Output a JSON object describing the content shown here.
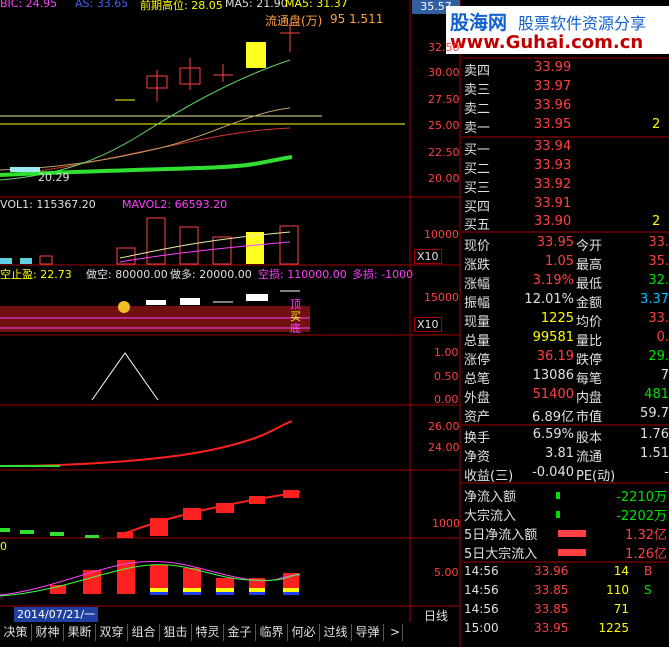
{
  "brand": {
    "logo_text": "股海网",
    "slogan": "股票软件资源分享",
    "url": "www.Guhai.com.cn"
  },
  "header": {
    "frag1": "BIC: 24.95",
    "frag2": "AS: 33.65",
    "frag3": "前期高位: 28.05",
    "frag4": "MA5: 21.90",
    "frag5": "MA5: 31.37",
    "float_label": "流通盘(万)",
    "float_val": "95  1.511",
    "price_box": "35.57"
  },
  "price_axis": [
    "32.50",
    "30.00",
    "27.50",
    "25.00",
    "22.50",
    "20.00"
  ],
  "low_label": "20.29",
  "vol_axis": [
    "10000"
  ],
  "x10": "X10",
  "x10_b": "X10",
  "vol_header": {
    "vol1": "VOL1: 115367.20",
    "vol2": "MAVOL2: 66593.20"
  },
  "sub_header": {
    "stop": "空止盈: 22.73",
    "short": "做空: 80000.00",
    "long": "做多: 20000.00",
    "air": "空损: 110000.00",
    "more": "多损: -1000"
  },
  "pane3_axis": [
    "15000"
  ],
  "pane3_marks": {
    "a": "顶",
    "b": "买",
    "c": "底"
  },
  "pane4_axis": [
    "1.00",
    "0.50",
    "0.00"
  ],
  "pane5_axis": [
    "26.00",
    "24.00"
  ],
  "pane6_axis": [
    "1000"
  ],
  "pane7_axis": [
    "5.00",
    "0"
  ],
  "date_label": "2014/07/21/一",
  "period": "日线",
  "sell_orders": [
    {
      "label": "卖四",
      "price": "33.99"
    },
    {
      "label": "卖三",
      "price": "33.97"
    },
    {
      "label": "卖二",
      "price": "33.96"
    },
    {
      "label": "卖一",
      "price": "33.95",
      "vol": "2"
    }
  ],
  "buy_orders": [
    {
      "label": "买一",
      "price": "33.94"
    },
    {
      "label": "买二",
      "price": "33.93"
    },
    {
      "label": "买三",
      "price": "33.92"
    },
    {
      "label": "买四",
      "price": "33.91"
    },
    {
      "label": "买五",
      "price": "33.90",
      "vol": "2"
    }
  ],
  "stats": [
    {
      "l1": "现价",
      "v1": "33.95",
      "c1": "#ff4040",
      "l2": "今开",
      "v2": "33.",
      "c2": "#ff4040"
    },
    {
      "l1": "涨跌",
      "v1": "1.05",
      "c1": "#ff4040",
      "l2": "最高",
      "v2": "35.",
      "c2": "#ff4040"
    },
    {
      "l1": "涨幅",
      "v1": "3.19%",
      "c1": "#ff4040",
      "l2": "最低",
      "v2": "32.",
      "c2": "#00e000"
    },
    {
      "l1": "振幅",
      "v1": "12.01%",
      "c1": "#e0e0e0",
      "l2": "金额",
      "v2": "3.37",
      "c2": "#00c0ff"
    },
    {
      "l1": "现量",
      "v1": "1225",
      "c1": "#ffff00",
      "l2": "均价",
      "v2": "33.",
      "c2": "#ff4040"
    },
    {
      "l1": "总量",
      "v1": "99581",
      "c1": "#ffff00",
      "l2": "量比",
      "v2": "0.",
      "c2": "#ff4040"
    },
    {
      "l1": "涨停",
      "v1": "36.19",
      "c1": "#ff4040",
      "l2": "跌停",
      "v2": "29.",
      "c2": "#00e000"
    },
    {
      "l1": "总笔",
      "v1": "13086",
      "c1": "#e0e0e0",
      "l2": "每笔",
      "v2": "7",
      "c2": "#e0e0e0"
    },
    {
      "l1": "外盘",
      "v1": "51400",
      "c1": "#ff4040",
      "l2": "内盘",
      "v2": "481",
      "c2": "#00e000"
    },
    {
      "l1": "资产",
      "v1": "6.89亿",
      "c1": "#e0e0e0",
      "l2": "市值",
      "v2": "59.7",
      "c2": "#e0e0e0"
    }
  ],
  "stats2": [
    {
      "l1": "换手",
      "v1": "6.59%",
      "c1": "#e0e0e0",
      "l2": "股本",
      "v2": "1.76",
      "c2": "#e0e0e0"
    },
    {
      "l1": "净资",
      "v1": "3.81",
      "c1": "#e0e0e0",
      "l2": "流通",
      "v2": "1.51",
      "c2": "#e0e0e0"
    },
    {
      "l1": "收益(三)",
      "v1": "-0.040",
      "c1": "#e0e0e0",
      "l2": "PE(动)",
      "v2": "-",
      "c2": "#e0e0e0"
    }
  ],
  "flows": [
    {
      "label": "净流入额",
      "value": "-2210万",
      "color": "#00e000"
    },
    {
      "label": "大宗流入",
      "value": "-2202万",
      "color": "#00e000"
    },
    {
      "label": "5日净流入额",
      "value": "1.32亿",
      "color": "#ff4040"
    },
    {
      "label": "5日大宗流入",
      "value": "1.26亿",
      "color": "#ff4040"
    }
  ],
  "ticks": [
    {
      "time": "14:56",
      "price": "33.96",
      "vol": "14",
      "side": "B",
      "side_color": "#ff4040"
    },
    {
      "time": "14:56",
      "price": "33.85",
      "vol": "110",
      "side": "S",
      "side_color": "#00e000"
    },
    {
      "time": "14:56",
      "price": "33.85",
      "vol": "71",
      "side": "",
      "side_color": "#e0e0e0"
    },
    {
      "time": "15:00",
      "price": "33.95",
      "vol": "1225",
      "side": "",
      "side_color": "#e0e0e0"
    }
  ],
  "tabs": [
    "决策",
    "财神",
    "果断",
    "双穿",
    "组合",
    "狙击",
    "特灵",
    "金子",
    "临界",
    "何必",
    "过线",
    "导弹"
  ],
  "tab_more": ">",
  "colors": {
    "up": "#ff4040",
    "down": "#00e000",
    "volume": "#ffff00",
    "grid": "#a00000"
  }
}
